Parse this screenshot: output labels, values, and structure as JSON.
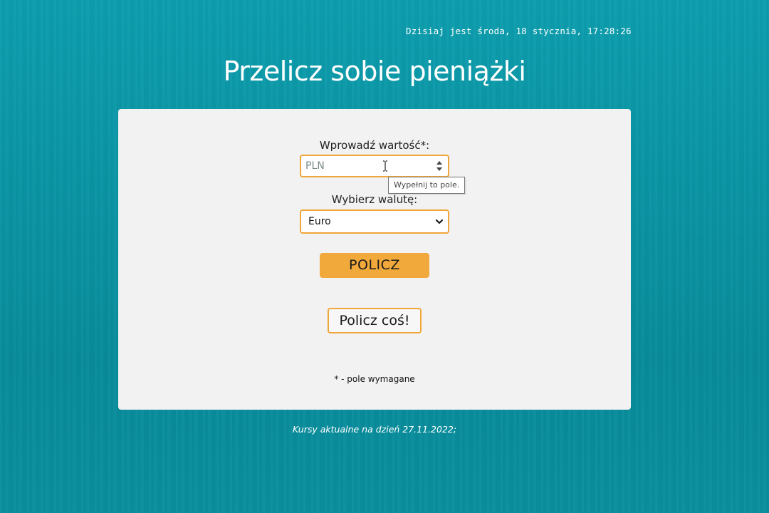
{
  "header": {
    "clock_text": "Dzisiaj jest środa, 18 stycznia, 17:28:26",
    "title": "Przelicz sobie pieniążki"
  },
  "form": {
    "amount_label": "Wprowadź wartość*:",
    "amount_placeholder": "PLN",
    "amount_value": "",
    "tooltip_text": "Wypełnij to pole.",
    "currency_label": "Wybierz walutę:",
    "currency_selected": "Euro",
    "submit_label": "POLICZ",
    "secondary_label": "Policz coś!",
    "required_note": "* - pole wymagane"
  },
  "footer": {
    "rates_note": "Kursy aktualne na dzień 27.11.2022;"
  },
  "colors": {
    "background": "#0a95a5",
    "card": "#f2f2f2",
    "accent": "#f2a93b"
  },
  "icons": {
    "spinner": "number-spinner-icon",
    "chevron": "chevron-down-icon",
    "cursor": "text-cursor-icon"
  }
}
